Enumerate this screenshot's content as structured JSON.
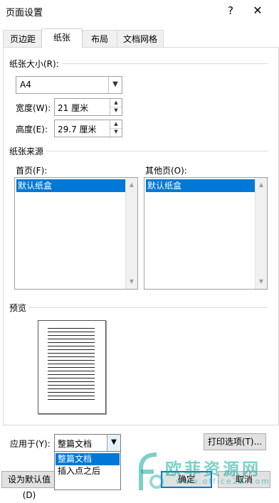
{
  "window": {
    "title": "页面设置",
    "help": "?",
    "close": "✕"
  },
  "tabs": [
    {
      "label": "页边距"
    },
    {
      "label": "纸张"
    },
    {
      "label": "布局"
    },
    {
      "label": "文档网格"
    }
  ],
  "active_tab": "纸张",
  "paper_size": {
    "section_label": "纸张大小(R):",
    "selected": "A4",
    "width_label": "宽度(W):",
    "width_value": "21 厘米",
    "height_label": "高度(E):",
    "height_value": "29.7 厘米"
  },
  "paper_source": {
    "section_label": "纸张来源",
    "first_page_label": "首页(F):",
    "first_page_selected": "默认纸盒",
    "other_pages_label": "其他页(O):",
    "other_pages_selected": "默认纸盒"
  },
  "preview": {
    "section_label": "预览"
  },
  "apply_to": {
    "label": "应用于(Y):",
    "value": "整篇文档",
    "options": [
      "整篇文档",
      "插入点之后"
    ]
  },
  "buttons": {
    "print_options": "打印选项(T)...",
    "set_default": "设为默认值(D)",
    "ok": "确定",
    "cancel": "取消"
  },
  "watermark": {
    "text": "欧菲资源网",
    "url": "www.office26.com"
  },
  "colors": {
    "selection": "#0078d7",
    "watermark": "#14aa9b"
  }
}
